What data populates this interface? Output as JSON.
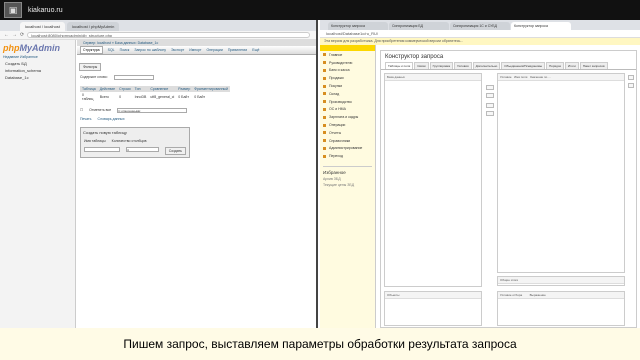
{
  "topbar": {
    "site": "kiakaruo.ru"
  },
  "left_browser": {
    "tabs": [
      "localhost / localhost",
      "localhost / phpMyAdmin"
    ],
    "address": "localhost:8080/phpmyadmin/db_structure.php",
    "pma": {
      "logo_a": "php",
      "logo_b": "MyAdmin",
      "side_links": "Недавние  Избранное",
      "databases": [
        "Создать БД",
        "information_schema",
        "Database_1c"
      ],
      "breadcrumb": "Сервер: localhost » База данных: Database_1c",
      "tabs": [
        "Структура",
        "SQL",
        "Поиск",
        "Запрос по шаблону",
        "Экспорт",
        "Импорт",
        "Операции",
        "Привилегии",
        "Ещё"
      ],
      "filter_label": "Фильтры",
      "filter_field": "Содержит слово:",
      "table_headers": [
        "Таблица",
        "Действие",
        "Строки",
        "Тип",
        "Сравнение",
        "Размер",
        "Фрагментированный"
      ],
      "table_row": [
        "0 таблиц",
        "Всего",
        "0",
        "InnoDB",
        "utf8_general_ci",
        "0 Байт",
        "0 Байт"
      ],
      "check_all": "Отметить все",
      "with_selected": "С отмеченными:",
      "print_link": "Печать",
      "dict_link": "Словарь данных",
      "create_table_btn": "Создать новую таблицу",
      "name_label": "Имя таблицы",
      "cols_label": "Количество столбцов",
      "cols_value": "4",
      "go_btn": "Создать"
    }
  },
  "right_browser": {
    "tabs": [
      "Конструктор запроса",
      "Синхронизация БД",
      "Синхронизация 1С и СУБД",
      "Конструктор запроса"
    ],
    "address": "localhost/Database1c/ru_RU/",
    "notice": "Эта версия для разработчика. Для приобретения коммерческой версии обратитесь...",
    "app_title": "Организация: ОО Предприятие",
    "menu": [
      "Главное",
      "Руководителю",
      "Банк и касса",
      "Продажи",
      "Покупки",
      "Склад",
      "Производство",
      "ОС и НМА",
      "Зарплата и кадры",
      "Операции",
      "Отчеты",
      "Справочники",
      "Администрирование",
      "Переход"
    ],
    "favorites_title": "Избранное",
    "favorites": [
      "Архив ЗБД",
      "Текущие цены ЗБД"
    ],
    "qb": {
      "title": "Конструктор запроса",
      "tabs": [
        "Таблицы и поля",
        "Связи",
        "Группировка",
        "Условия",
        "Дополнительно",
        "Объединения/Псевдонимы",
        "Порядок",
        "Итоги",
        "Пакет запросов"
      ],
      "db_header": "База данных",
      "res_header": "Поля",
      "res_cols": [
        "Условие",
        "Имя поля",
        "Значение по ..."
      ],
      "bottom_header": "Объекты",
      "bottom_cols": [
        "Условие отбора",
        "Выражение"
      ],
      "query_label": "Общие итоги"
    }
  },
  "subtitle": "Пишем запрос, выставляем параметры обработки результата запроса"
}
